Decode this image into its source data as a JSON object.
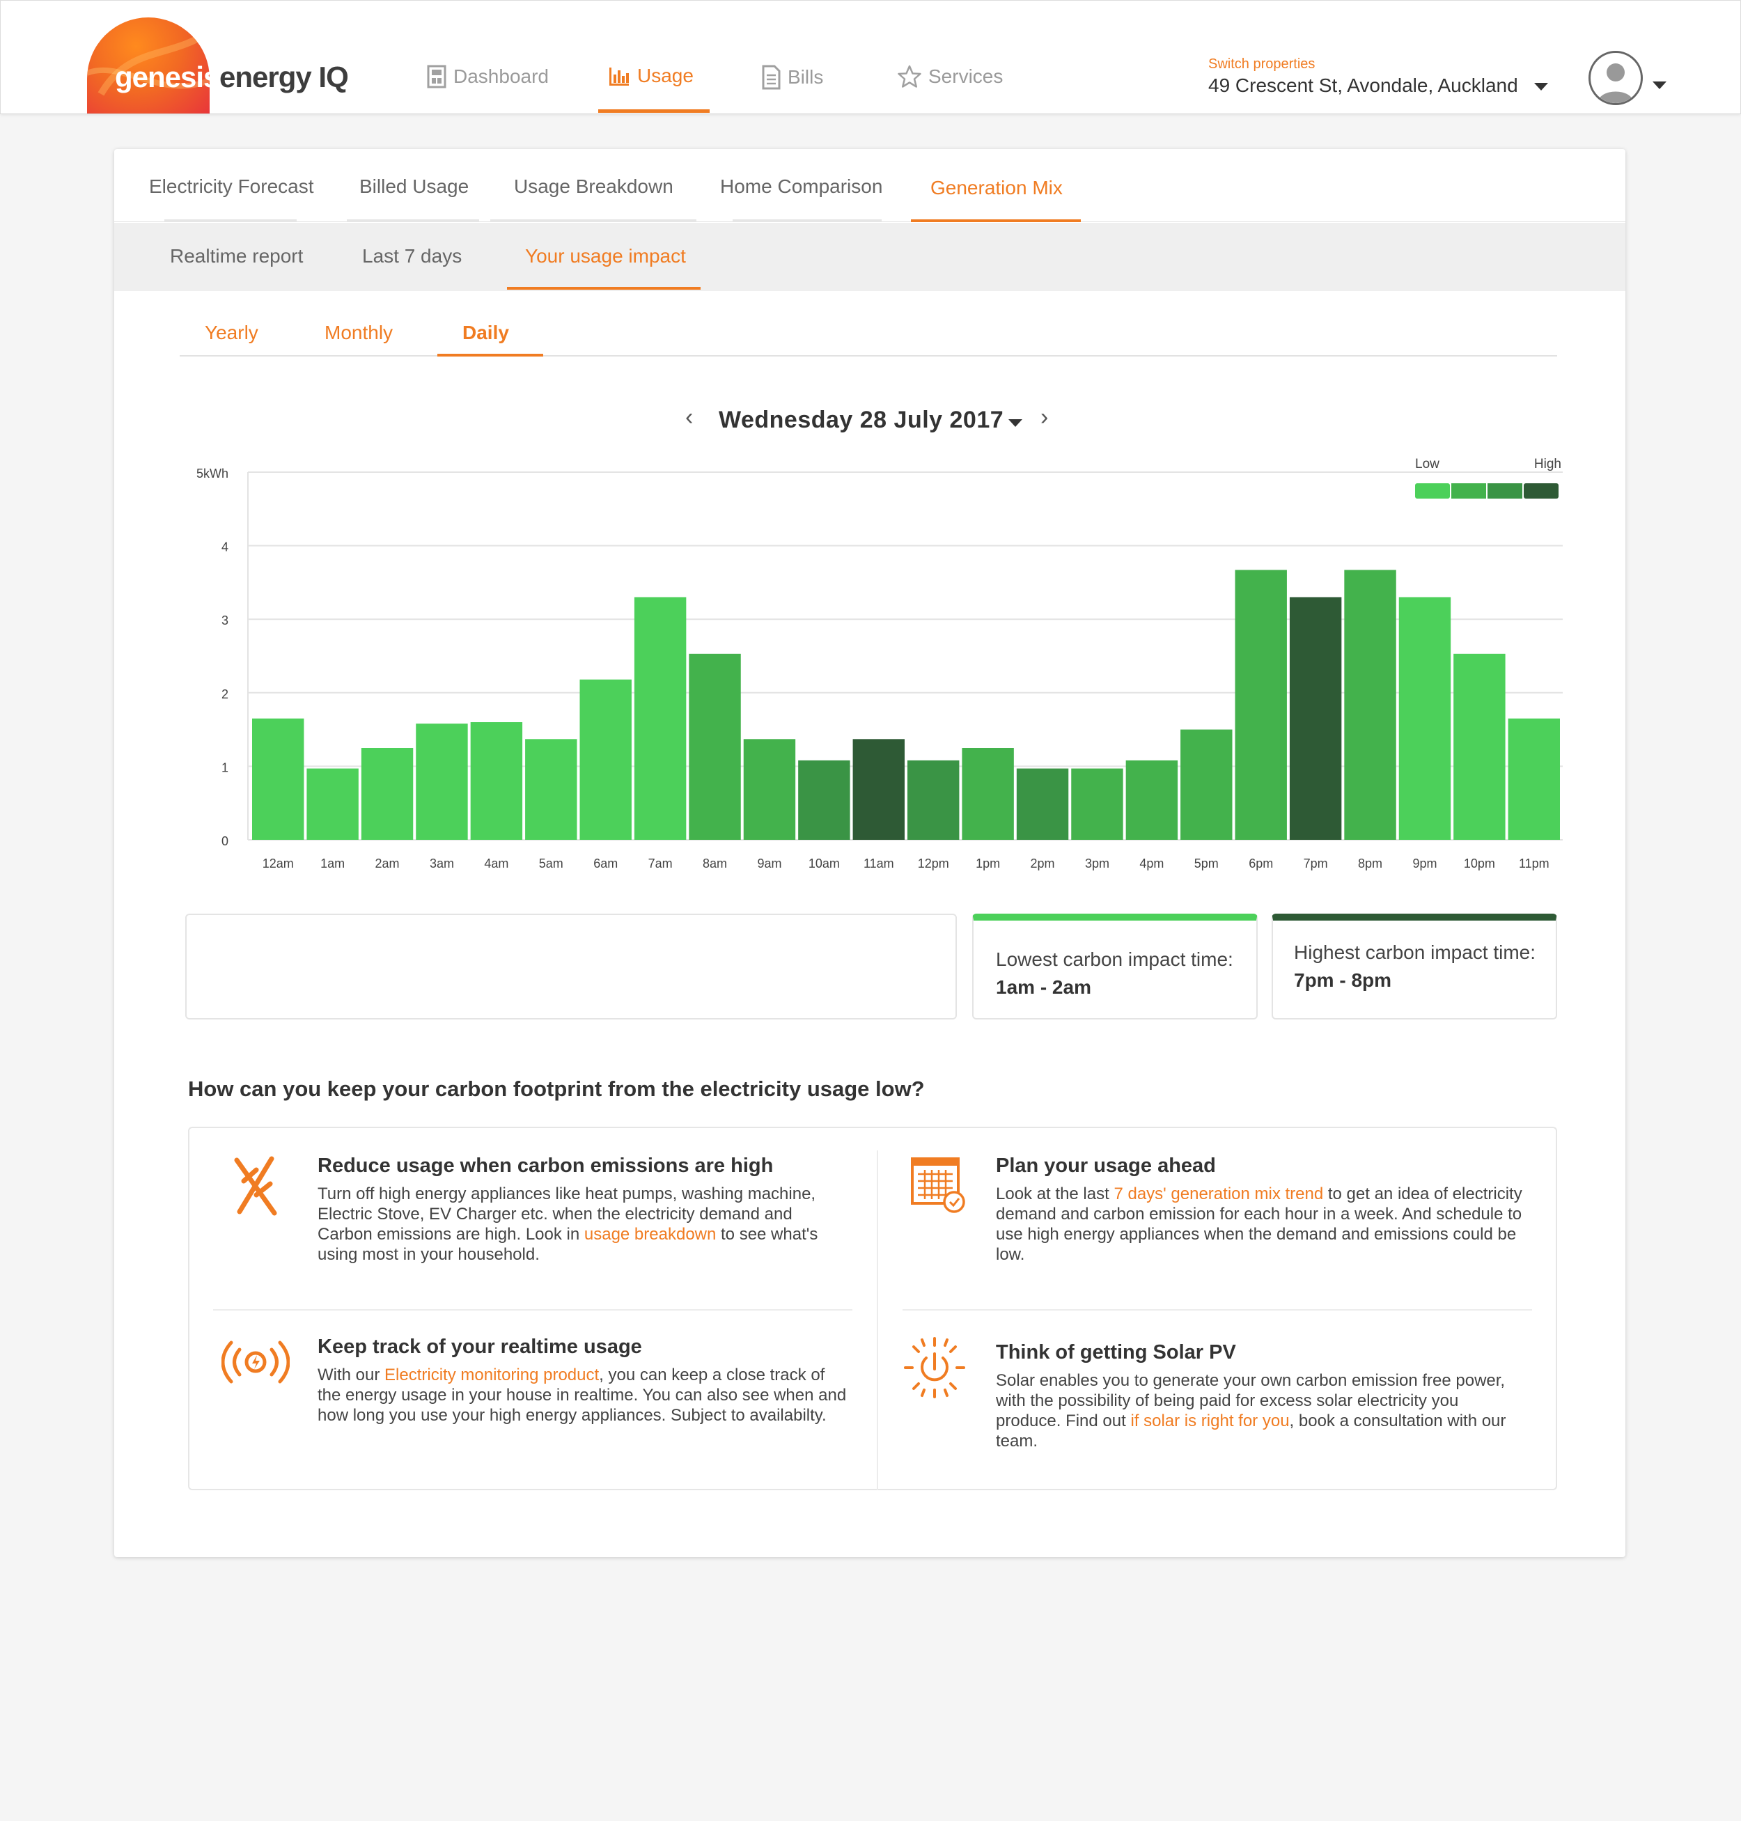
{
  "brand": {
    "word1": "genesis",
    "word2": "energy IQ"
  },
  "nav": {
    "items": [
      {
        "label": "Dashboard"
      },
      {
        "label": "Usage"
      },
      {
        "label": "Bills"
      },
      {
        "label": "Services"
      }
    ],
    "active": "Usage"
  },
  "property": {
    "switch_label": "Switch properties",
    "address": "49 Crescent St, Avondale, Auckland"
  },
  "tabs_primary": [
    "Electricity Forecast",
    "Billed Usage",
    "Usage Breakdown",
    "Home Comparison",
    "Generation Mix"
  ],
  "tabs_secondary": [
    "Realtime report",
    "Last 7 days",
    "Your usage impact"
  ],
  "tabs_period": [
    "Yearly",
    "Monthly",
    "Daily"
  ],
  "date_title": "Wednesday 28 July 2017",
  "legend": {
    "low": "Low",
    "high": "High",
    "colors": [
      "#4cd05a",
      "#43b24c",
      "#3a9445",
      "#2e5a35"
    ]
  },
  "chart_data": {
    "type": "bar",
    "ylabel": "",
    "y_ticks": [
      "5kWh",
      "4",
      "3",
      "2",
      "1",
      "0"
    ],
    "ylim": [
      0,
      5
    ],
    "categories": [
      "12am",
      "1am",
      "2am",
      "3am",
      "4am",
      "5am",
      "6am",
      "7am",
      "8am",
      "9am",
      "10am",
      "11am",
      "12pm",
      "1pm",
      "2pm",
      "3pm",
      "4pm",
      "5pm",
      "6pm",
      "7pm",
      "8pm",
      "9pm",
      "10pm",
      "11pm"
    ],
    "values": [
      1.65,
      0.97,
      1.25,
      1.58,
      1.6,
      1.37,
      2.18,
      3.3,
      2.53,
      1.37,
      1.08,
      1.37,
      1.08,
      1.25,
      0.97,
      0.97,
      1.08,
      1.5,
      3.67,
      3.3,
      3.67,
      3.3,
      2.53,
      1.65
    ],
    "carbon_level": [
      0,
      0,
      0,
      0,
      0,
      0,
      0,
      0,
      1,
      1,
      2,
      3,
      2,
      1,
      2,
      1,
      1,
      1,
      1,
      3,
      1,
      0,
      0,
      0
    ],
    "grid": true,
    "legend_position": "top-right"
  },
  "info": {
    "lowest_title": "Lowest carbon impact time:",
    "lowest_value": "1am - 2am",
    "lowest_color": "#4cd05a",
    "highest_title": "Highest carbon impact time:",
    "highest_value": "7pm - 8pm",
    "highest_color": "#2e5a35"
  },
  "question": "How can you keep your carbon footprint from the electricity usage low?",
  "tips": [
    {
      "icon": "plug-off-icon",
      "title": "Reduce usage when carbon emissions are high",
      "text_before": "Turn off high energy appliances like heat pumps, washing machine, Electric Stove, EV Charger etc. when the electricity demand and Carbon emissions are high. Look in ",
      "link": "usage breakdown",
      "text_after": " to see what's using most in your household."
    },
    {
      "icon": "calendar-clock-icon",
      "title": "Plan your usage ahead",
      "text_before": "Look at the last ",
      "link": "7 days' generation mix trend",
      "text_after": " to get an idea of electricity demand and carbon emission for each hour in a week. And schedule to use high energy appliances when the demand and emissions could be low."
    },
    {
      "icon": "realtime-signal-icon",
      "title": "Keep track of your realtime usage",
      "text_before": "With our ",
      "link": "Electricity monitoring product",
      "text_after": ", you can keep a close track of the energy usage in your house in realtime. You can also see when and how long you use your high energy appliances. Subject to availabilty."
    },
    {
      "icon": "solar-power-icon",
      "title": "Think of getting Solar PV",
      "text_before": "Solar enables you to generate your own carbon emission free power, with the possibility of being paid for excess solar electricity you produce. Find out ",
      "link": "if solar is right for you",
      "text_after": ", book a consultation with our team."
    }
  ],
  "colors": {
    "accent": "#f07c22"
  }
}
